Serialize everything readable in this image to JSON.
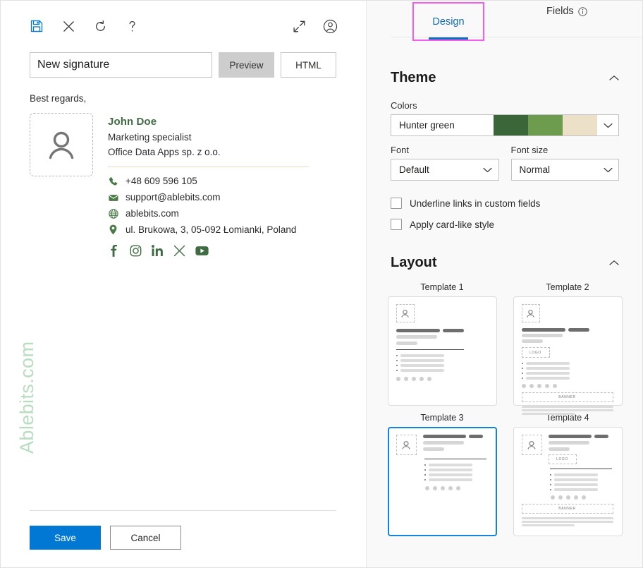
{
  "toolbar": {
    "save_icon": "save-floppy-icon",
    "close_icon": "close-x-icon",
    "refresh_icon": "refresh-icon",
    "help_icon": "help-question-icon",
    "expand_icon": "expand-arrows-icon",
    "account_icon": "account-person-icon",
    "save_icon_color": "#0078d4",
    "icon_color": "#3b3a39"
  },
  "editor": {
    "signature_name_value": "New signature",
    "signature_name_placeholder": "New signature",
    "preview_label": "Preview",
    "html_label": "HTML",
    "active_view": "Preview"
  },
  "signature": {
    "greeting": "Best regards,",
    "avatar_icon": "person-placeholder-icon",
    "name": "John Doe",
    "job_title": "Marketing specialist",
    "company": "Office Data Apps sp. z o.o.",
    "accent_color": "#3e6b42",
    "divider_color": "#e8dcc2",
    "contacts": [
      {
        "icon": "phone-icon",
        "text": "+48 609 596 105"
      },
      {
        "icon": "email-icon",
        "text": "support@ablebits.com"
      },
      {
        "icon": "globe-icon",
        "text": "ablebits.com"
      },
      {
        "icon": "location-pin-icon",
        "text": "ul. Brukowa, 3, 05-092 Łomianki, Poland"
      }
    ],
    "socials": [
      {
        "icon": "facebook-icon",
        "label": "Facebook"
      },
      {
        "icon": "instagram-icon",
        "label": "Instagram"
      },
      {
        "icon": "linkedin-icon",
        "label": "LinkedIn"
      },
      {
        "icon": "x-twitter-icon",
        "label": "X"
      },
      {
        "icon": "youtube-icon",
        "label": "YouTube"
      }
    ]
  },
  "watermark": {
    "text": "Ablebits.com",
    "color": "#b8ddc0"
  },
  "footer": {
    "save_label": "Save",
    "cancel_label": "Cancel",
    "save_color": "#0078d4"
  },
  "panel": {
    "tabs": [
      {
        "label": "Design",
        "selected": true,
        "highlight_color": "#f45cf4",
        "active_color": "#0f6cbd"
      },
      {
        "label": "Fields",
        "selected": false,
        "info_icon": "info-circle-icon"
      }
    ],
    "theme": {
      "title": "Theme",
      "collapse_icon": "chevron-up-icon",
      "colors_label": "Colors",
      "colors_value": "Hunter green",
      "colors_swatches": [
        "#3b6639",
        "#6e9c4e",
        "#ece0c8"
      ],
      "font_label": "Font",
      "font_value": "Default",
      "font_size_label": "Font size",
      "font_size_value": "Normal",
      "dropdown_icon": "chevron-down-icon",
      "checkboxes": [
        {
          "label": "Underline links in custom fields",
          "checked": false
        },
        {
          "label": "Apply card-like style",
          "checked": false
        }
      ]
    },
    "layout": {
      "title": "Layout",
      "collapse_icon": "chevron-up-icon",
      "templates": [
        {
          "label": "Template 1",
          "selected": false,
          "has_logo": false,
          "has_banner": false
        },
        {
          "label": "Template 2",
          "selected": false,
          "has_logo": true,
          "has_banner": true,
          "logo_label": "LOGO",
          "banner_label": "BANNER"
        },
        {
          "label": "Template 3",
          "selected": true,
          "has_logo": false,
          "has_banner": false
        },
        {
          "label": "Template 4",
          "selected": false,
          "has_logo": true,
          "has_banner": true,
          "logo_label": "LOGO",
          "banner_label": "BANNER"
        }
      ],
      "selected_border_color": "#1384d8"
    }
  }
}
